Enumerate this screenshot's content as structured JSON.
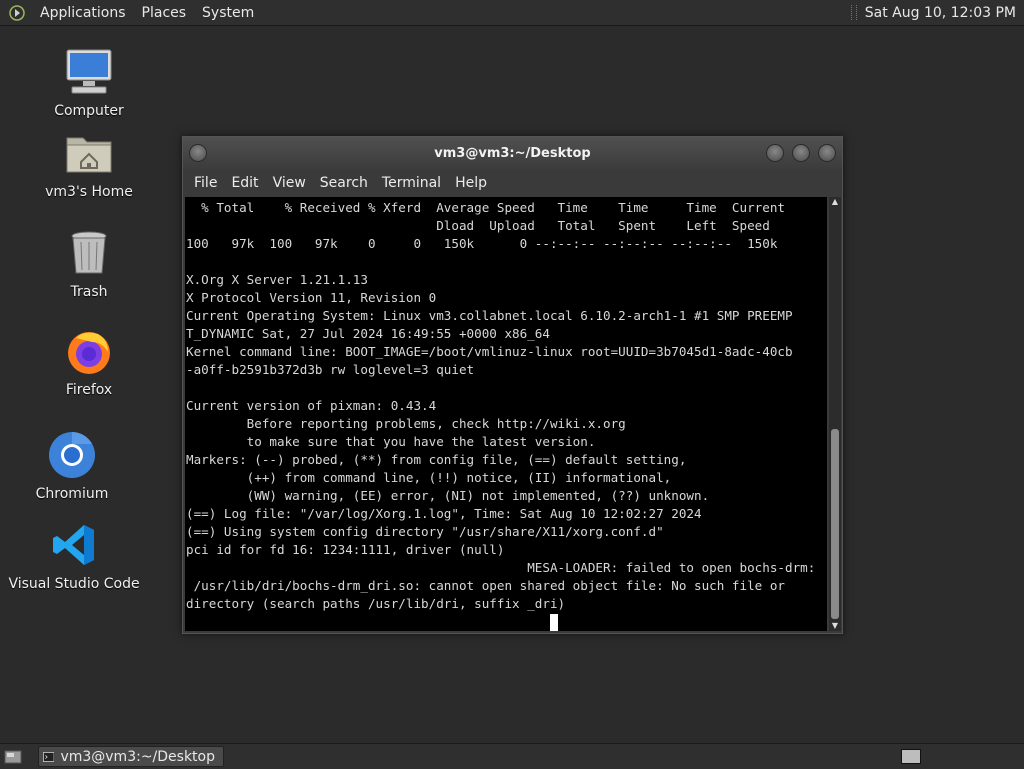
{
  "top_panel": {
    "menus": [
      "Applications",
      "Places",
      "System"
    ],
    "clock": "Sat Aug 10, 12:03 PM"
  },
  "desktop_icons": [
    {
      "label": "Computer",
      "icon": "computer-icon"
    },
    {
      "label": "vm3's Home",
      "icon": "home-folder-icon"
    },
    {
      "label": "Trash",
      "icon": "trash-icon"
    },
    {
      "label": "Firefox",
      "icon": "firefox-icon"
    },
    {
      "label": "Chromium",
      "icon": "chromium-icon"
    },
    {
      "label": "Visual Studio Code",
      "icon": "vscode-icon"
    }
  ],
  "terminal": {
    "title": "vm3@vm3:~/Desktop",
    "menu": [
      "File",
      "Edit",
      "View",
      "Search",
      "Terminal",
      "Help"
    ],
    "lines": [
      "  % Total    % Received % Xferd  Average Speed   Time    Time     Time  Current",
      "                                 Dload  Upload   Total   Spent    Left  Speed",
      "100   97k  100   97k    0     0   150k      0 --:--:-- --:--:-- --:--:--  150k",
      "",
      "X.Org X Server 1.21.1.13",
      "X Protocol Version 11, Revision 0",
      "Current Operating System: Linux vm3.collabnet.local 6.10.2-arch1-1 #1 SMP PREEMP",
      "T_DYNAMIC Sat, 27 Jul 2024 16:49:55 +0000 x86_64",
      "Kernel command line: BOOT_IMAGE=/boot/vmlinuz-linux root=UUID=3b7045d1-8adc-40cb",
      "-a0ff-b2591b372d3b rw loglevel=3 quiet",
      "",
      "Current version of pixman: 0.43.4",
      "        Before reporting problems, check http://wiki.x.org",
      "        to make sure that you have the latest version.",
      "Markers: (--) probed, (**) from config file, (==) default setting,",
      "        (++) from command line, (!!) notice, (II) informational,",
      "        (WW) warning, (EE) error, (NI) not implemented, (??) unknown.",
      "(==) Log file: \"/var/log/Xorg.1.log\", Time: Sat Aug 10 12:02:27 2024",
      "(==) Using system config directory \"/usr/share/X11/xorg.conf.d\"",
      "pci id for fd 16: 1234:1111, driver (null)",
      "                                             MESA-LOADER: failed to open bochs-drm:",
      " /usr/lib/dri/bochs-drm_dri.so: cannot open shared object file: No such file or",
      "directory (search paths /usr/lib/dri, suffix _dri)"
    ],
    "cursor_indent": "                                                "
  },
  "taskbar": {
    "window_label": "vm3@vm3:~/Desktop"
  }
}
